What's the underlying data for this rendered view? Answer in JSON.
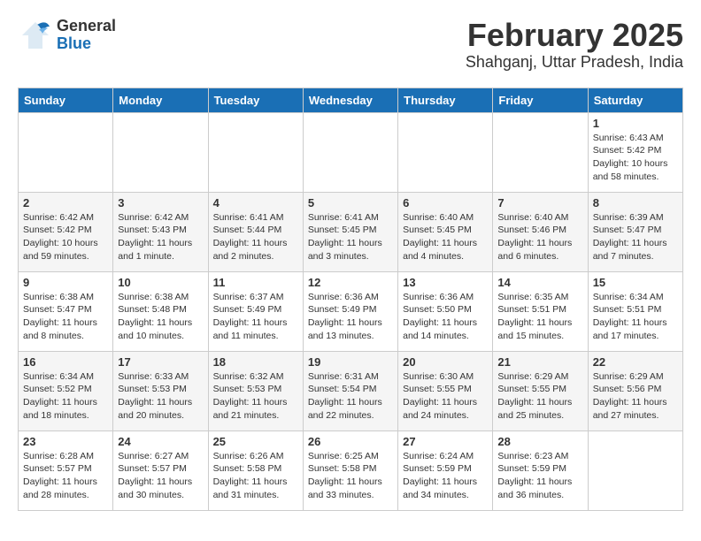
{
  "header": {
    "logo_general": "General",
    "logo_blue": "Blue",
    "month_year": "February 2025",
    "location": "Shahganj, Uttar Pradesh, India"
  },
  "days_of_week": [
    "Sunday",
    "Monday",
    "Tuesday",
    "Wednesday",
    "Thursday",
    "Friday",
    "Saturday"
  ],
  "weeks": [
    [
      {
        "day": "",
        "info": ""
      },
      {
        "day": "",
        "info": ""
      },
      {
        "day": "",
        "info": ""
      },
      {
        "day": "",
        "info": ""
      },
      {
        "day": "",
        "info": ""
      },
      {
        "day": "",
        "info": ""
      },
      {
        "day": "1",
        "info": "Sunrise: 6:43 AM\nSunset: 5:42 PM\nDaylight: 10 hours\nand 58 minutes."
      }
    ],
    [
      {
        "day": "2",
        "info": "Sunrise: 6:42 AM\nSunset: 5:42 PM\nDaylight: 10 hours\nand 59 minutes."
      },
      {
        "day": "3",
        "info": "Sunrise: 6:42 AM\nSunset: 5:43 PM\nDaylight: 11 hours\nand 1 minute."
      },
      {
        "day": "4",
        "info": "Sunrise: 6:41 AM\nSunset: 5:44 PM\nDaylight: 11 hours\nand 2 minutes."
      },
      {
        "day": "5",
        "info": "Sunrise: 6:41 AM\nSunset: 5:45 PM\nDaylight: 11 hours\nand 3 minutes."
      },
      {
        "day": "6",
        "info": "Sunrise: 6:40 AM\nSunset: 5:45 PM\nDaylight: 11 hours\nand 4 minutes."
      },
      {
        "day": "7",
        "info": "Sunrise: 6:40 AM\nSunset: 5:46 PM\nDaylight: 11 hours\nand 6 minutes."
      },
      {
        "day": "8",
        "info": "Sunrise: 6:39 AM\nSunset: 5:47 PM\nDaylight: 11 hours\nand 7 minutes."
      }
    ],
    [
      {
        "day": "9",
        "info": "Sunrise: 6:38 AM\nSunset: 5:47 PM\nDaylight: 11 hours\nand 8 minutes."
      },
      {
        "day": "10",
        "info": "Sunrise: 6:38 AM\nSunset: 5:48 PM\nDaylight: 11 hours\nand 10 minutes."
      },
      {
        "day": "11",
        "info": "Sunrise: 6:37 AM\nSunset: 5:49 PM\nDaylight: 11 hours\nand 11 minutes."
      },
      {
        "day": "12",
        "info": "Sunrise: 6:36 AM\nSunset: 5:49 PM\nDaylight: 11 hours\nand 13 minutes."
      },
      {
        "day": "13",
        "info": "Sunrise: 6:36 AM\nSunset: 5:50 PM\nDaylight: 11 hours\nand 14 minutes."
      },
      {
        "day": "14",
        "info": "Sunrise: 6:35 AM\nSunset: 5:51 PM\nDaylight: 11 hours\nand 15 minutes."
      },
      {
        "day": "15",
        "info": "Sunrise: 6:34 AM\nSunset: 5:51 PM\nDaylight: 11 hours\nand 17 minutes."
      }
    ],
    [
      {
        "day": "16",
        "info": "Sunrise: 6:34 AM\nSunset: 5:52 PM\nDaylight: 11 hours\nand 18 minutes."
      },
      {
        "day": "17",
        "info": "Sunrise: 6:33 AM\nSunset: 5:53 PM\nDaylight: 11 hours\nand 20 minutes."
      },
      {
        "day": "18",
        "info": "Sunrise: 6:32 AM\nSunset: 5:53 PM\nDaylight: 11 hours\nand 21 minutes."
      },
      {
        "day": "19",
        "info": "Sunrise: 6:31 AM\nSunset: 5:54 PM\nDaylight: 11 hours\nand 22 minutes."
      },
      {
        "day": "20",
        "info": "Sunrise: 6:30 AM\nSunset: 5:55 PM\nDaylight: 11 hours\nand 24 minutes."
      },
      {
        "day": "21",
        "info": "Sunrise: 6:29 AM\nSunset: 5:55 PM\nDaylight: 11 hours\nand 25 minutes."
      },
      {
        "day": "22",
        "info": "Sunrise: 6:29 AM\nSunset: 5:56 PM\nDaylight: 11 hours\nand 27 minutes."
      }
    ],
    [
      {
        "day": "23",
        "info": "Sunrise: 6:28 AM\nSunset: 5:57 PM\nDaylight: 11 hours\nand 28 minutes."
      },
      {
        "day": "24",
        "info": "Sunrise: 6:27 AM\nSunset: 5:57 PM\nDaylight: 11 hours\nand 30 minutes."
      },
      {
        "day": "25",
        "info": "Sunrise: 6:26 AM\nSunset: 5:58 PM\nDaylight: 11 hours\nand 31 minutes."
      },
      {
        "day": "26",
        "info": "Sunrise: 6:25 AM\nSunset: 5:58 PM\nDaylight: 11 hours\nand 33 minutes."
      },
      {
        "day": "27",
        "info": "Sunrise: 6:24 AM\nSunset: 5:59 PM\nDaylight: 11 hours\nand 34 minutes."
      },
      {
        "day": "28",
        "info": "Sunrise: 6:23 AM\nSunset: 5:59 PM\nDaylight: 11 hours\nand 36 minutes."
      },
      {
        "day": "",
        "info": ""
      }
    ]
  ]
}
